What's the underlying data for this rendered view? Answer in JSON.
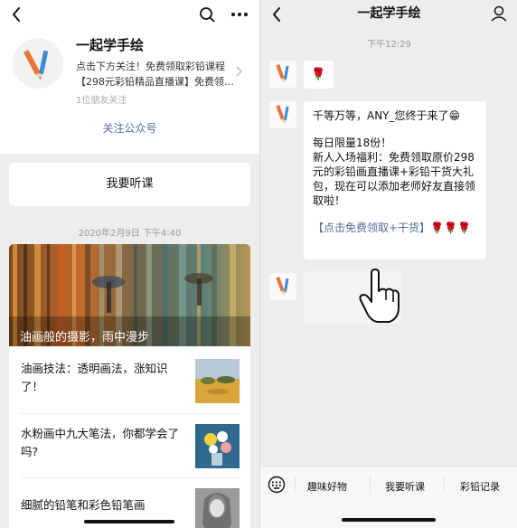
{
  "left": {
    "account": {
      "name": "一起学手绘",
      "desc_line1": "点击下方关注！免费领取彩铅课程",
      "desc_line2": "【298元彩铅精品直播课】免费领…",
      "followers": "1位朋友关注",
      "follow_label": "关注公众号"
    },
    "listen_button": "我要听课",
    "timestamp": "2020年2月9日 下午4:40",
    "articles": {
      "cover_title": "油画般的摄影，雨中漫步",
      "items": [
        {
          "title": "油画技法：透明画法，涨知识了！"
        },
        {
          "title": "水粉画中九大笔法，你都学会了吗?"
        },
        {
          "title": "细腻的铅笔和彩色铅笔画"
        }
      ]
    }
  },
  "right": {
    "title": "一起学手绘",
    "time": "下午12:29",
    "msg1": "🌹",
    "msg2": {
      "line1": "千等万等，ANY_您终于来了😁",
      "line2": "每日限量18份！",
      "line3": "新人入场福利：免费领取原价298元的彩铅画直播课+彩铅干货大礼包，现在可以添加老师好友直接领取啦！",
      "link": "【点击免费领取+干货】",
      "roses": "🌹🌹🌹"
    },
    "menu": [
      "趣味好物",
      "我要听课",
      "彩铅记录"
    ]
  },
  "colors": {
    "link": "#576b95",
    "background": "#ededed"
  },
  "icons": [
    "back-arrow-icon",
    "search-icon",
    "more-icon",
    "profile-icon",
    "keyboard-icon",
    "hand-pointer-icon",
    "chevron-right-icon"
  ]
}
